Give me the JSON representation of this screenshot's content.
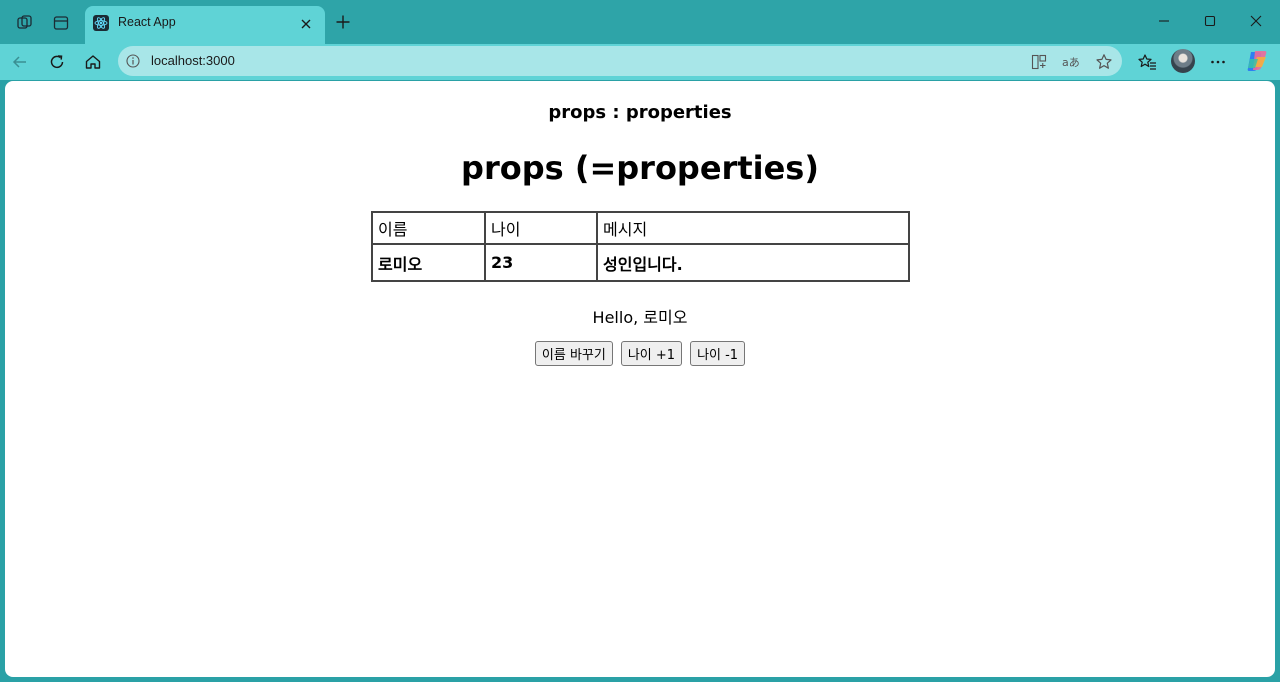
{
  "browser": {
    "tab": {
      "title": "React App"
    },
    "address": {
      "url": "localhost:3000"
    }
  },
  "page": {
    "subtitle": "props : properties",
    "heading": "props (=properties)",
    "table": {
      "rows": [
        [
          "이름",
          "나이",
          "메시지"
        ],
        [
          "로미오",
          "23",
          "성인입니다."
        ]
      ]
    },
    "greeting": "Hello, 로미오",
    "buttons": {
      "change_name": "이름 바꾸기",
      "age_plus": "나이 +1",
      "age_minus": "나이 -1"
    }
  }
}
